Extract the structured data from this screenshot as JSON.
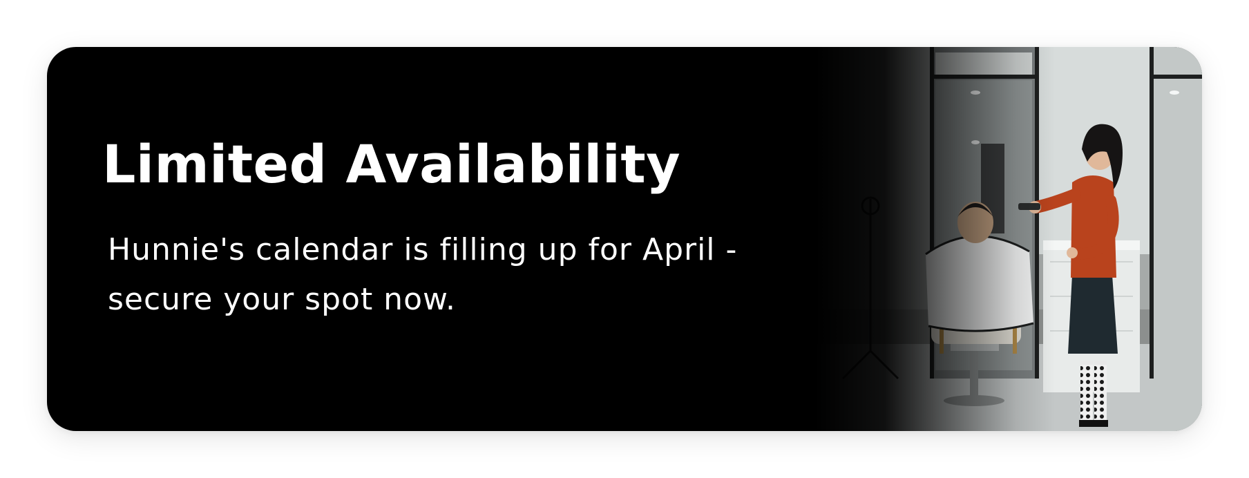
{
  "banner": {
    "title": "Limited Availability",
    "subtitle": "Hunnie's calendar is filling up for April - secure your spot now.",
    "background_color": "#000000",
    "text_color": "#ffffff",
    "image": {
      "subject": "stylist-cutting-client-hair-in-salon"
    }
  }
}
